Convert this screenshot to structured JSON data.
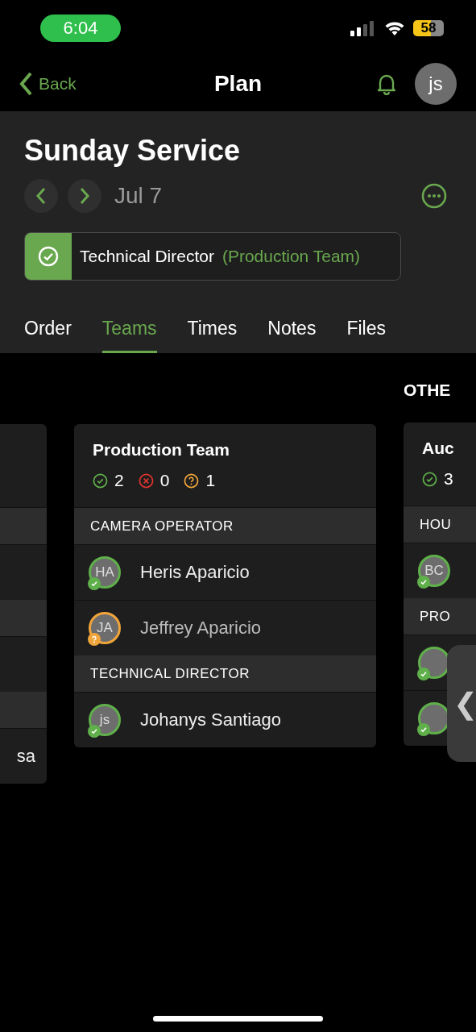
{
  "status_bar": {
    "time": "6:04",
    "battery": "58"
  },
  "nav": {
    "back": "Back",
    "title": "Plan",
    "avatar": "js"
  },
  "plan": {
    "title": "Sunday Service",
    "date": "Jul 7",
    "role": {
      "title": "Technical Director",
      "team": "(Production Team)",
      "confirmed": true
    }
  },
  "tabs": [
    {
      "label": "Order",
      "selected": false
    },
    {
      "label": "Teams",
      "selected": true
    },
    {
      "label": "Times",
      "selected": false
    },
    {
      "label": "Notes",
      "selected": false
    },
    {
      "label": "Files",
      "selected": false
    }
  ],
  "groups": [
    {
      "cards": [
        {
          "rows": [
            {
              "kind": "section"
            },
            {
              "kind": "member"
            },
            {
              "kind": "section"
            },
            {
              "kind": "member"
            },
            {
              "kind": "section"
            },
            {
              "kind": "member",
              "name": "sa"
            }
          ]
        }
      ]
    },
    {
      "cards": [
        {
          "title": "Production Team",
          "counts": [
            {
              "kind": "confirmed",
              "value": "2"
            },
            {
              "kind": "declined",
              "value": "0"
            },
            {
              "kind": "pending",
              "value": "1"
            }
          ],
          "rows": [
            {
              "kind": "section",
              "name": "CAMERA OPERATOR"
            },
            {
              "kind": "member",
              "initials": "HA",
              "name": "Heris Aparicio",
              "confirmed": true
            },
            {
              "kind": "member",
              "initials": "JA",
              "name": "Jeffrey Aparicio",
              "confirmed": false
            },
            {
              "kind": "section",
              "name": "TECHNICAL DIRECTOR"
            },
            {
              "kind": "member",
              "initials": "js",
              "name": "Johanys Santiago",
              "confirmed": true
            }
          ]
        }
      ]
    },
    {
      "heading": "OTHE",
      "cards": [
        {
          "title": "Auc",
          "counts": [
            {
              "kind": "confirmed",
              "value": "3"
            }
          ],
          "rows": [
            {
              "kind": "section",
              "name": "HOU"
            },
            {
              "kind": "member",
              "initials": "BC",
              "confirmed": true
            },
            {
              "kind": "section",
              "name": "PRO"
            },
            {
              "kind": "member",
              "confirmed": true
            },
            {
              "kind": "member",
              "confirmed": true
            }
          ]
        }
      ]
    }
  ],
  "side_handle": {
    "glyph": "❮"
  }
}
